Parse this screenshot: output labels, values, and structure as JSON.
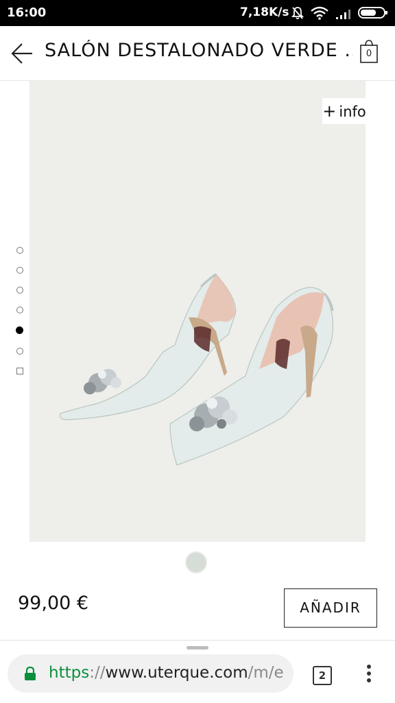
{
  "status_bar": {
    "time": "16:00",
    "network_speed": "7,18K/s",
    "icons": [
      "mute-icon",
      "wifi-icon",
      "signal-icon",
      "battery-icon"
    ]
  },
  "app_bar": {
    "title": "SALÓN DESTALONADO VERDE ...",
    "cart_count": "0",
    "icons": [
      "back-arrow-icon",
      "shopping-bag-icon"
    ]
  },
  "product": {
    "info_label": "info",
    "image_count": 7,
    "active_image_index": 4,
    "color_swatch": "#d6dcd6",
    "price": "99,00  €",
    "add_button_label": "AÑADIR"
  },
  "browser": {
    "url_scheme": "https",
    "url_separator": "://",
    "url_host": "www.uterque.com",
    "url_path": "/m/e",
    "tab_count": "2",
    "icons": [
      "lock-icon",
      "overflow-menu-icon"
    ]
  },
  "colors": {
    "status_bar_bg": "#000000",
    "secure_green": "#0a8f3d",
    "product_bg": "#eeeeea"
  }
}
